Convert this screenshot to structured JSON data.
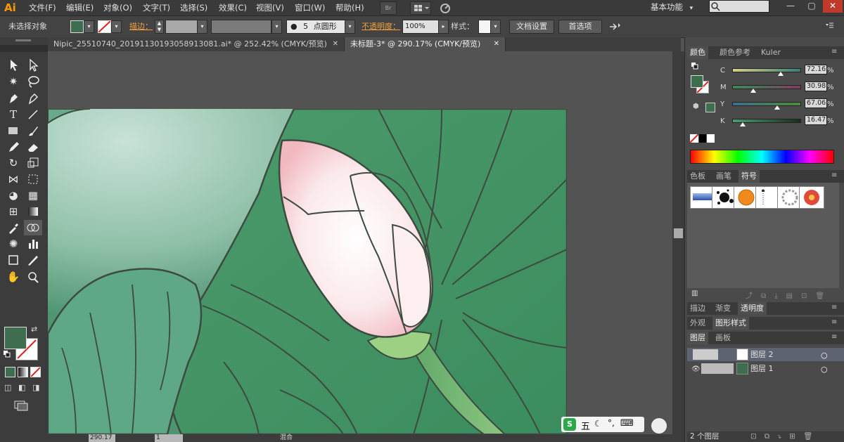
{
  "app": {
    "logo": "Ai"
  },
  "menu": [
    "文件(F)",
    "编辑(E)",
    "对象(O)",
    "文字(T)",
    "选择(S)",
    "效果(C)",
    "视图(V)",
    "窗口(W)",
    "帮助(H)"
  ],
  "menu_buttons": {
    "bridge": "Br"
  },
  "workspace": {
    "label": "基本功能",
    "arrow": "▾"
  },
  "window_controls": {
    "minimize": "—",
    "maximize": "▢",
    "close": "✕"
  },
  "control_bar": {
    "selection_status": "未选择对象",
    "stroke_label": "描边：",
    "brush_size": "5",
    "brush_label": "点圆形",
    "opacity_label": "不透明度：",
    "opacity_value": "100%",
    "style_label": "样式：",
    "doc_setup_button": "文档设置",
    "preferences_button": "首选项",
    "fill_color": "#3e6e4f"
  },
  "tabs": [
    {
      "label": "Nipic_25510740_20191130193058913081.ai* @ 252.42% (CMYK/预览)",
      "close": "✕"
    },
    {
      "label": "未标题-3* @ 290.17% (CMYK/预览)",
      "close": "✕"
    }
  ],
  "status_bar": {
    "zoom": "290.17",
    "page": "1",
    "mode": "混合"
  },
  "color_panel": {
    "tabs": [
      "颜色",
      "颜色参考",
      "Kuler"
    ],
    "channels": [
      {
        "label": "C",
        "value": "72.16",
        "fraction": 0.72
      },
      {
        "label": "M",
        "value": "30.98",
        "fraction": 0.31
      },
      {
        "label": "Y",
        "value": "67.06",
        "fraction": 0.67
      },
      {
        "label": "K",
        "value": "16.47",
        "fraction": 0.16
      }
    ],
    "unit": "%"
  },
  "symbol_panel": {
    "tabs": [
      "色板",
      "画笔",
      "符号"
    ]
  },
  "appearance_tabs": [
    "描边",
    "渐变",
    "透明度"
  ],
  "styles_tabs": [
    "外观",
    "图形样式"
  ],
  "layers_tabs": [
    "图层",
    "画板"
  ],
  "layers": [
    "图层 2",
    "图层 1"
  ],
  "layers_count": "2 个图层",
  "ime": {
    "logo": "S",
    "mode": "五"
  },
  "colors": {
    "accent": "#f2a23c",
    "fill": "#3e6e4f",
    "leaf": "#3f8a5e",
    "bud": "#f7d9dd"
  }
}
